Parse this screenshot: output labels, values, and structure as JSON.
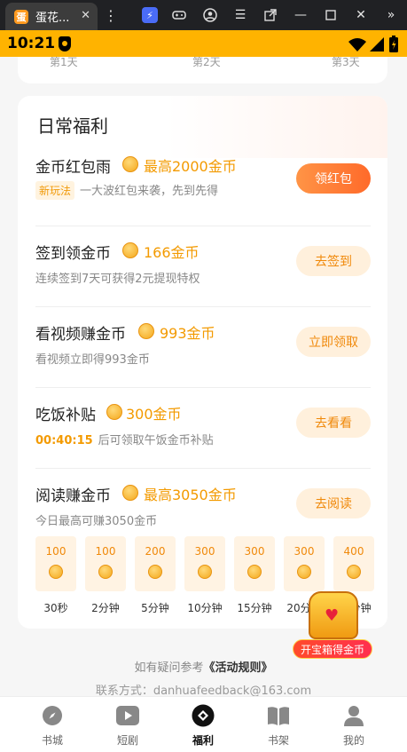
{
  "browser": {
    "tab_title": "蛋花...",
    "tab_close": "✕"
  },
  "status": {
    "time": "10:21"
  },
  "check_days": [
    "第1天",
    "第2天",
    "第3天"
  ],
  "section": {
    "title": "日常福利"
  },
  "tasks": [
    {
      "name": "金币红包雨",
      "reward": "最高2000金币",
      "badge": "新玩法",
      "desc": "一大波红包来袭，先到先得",
      "button": "领红包"
    },
    {
      "name": "签到领金币",
      "reward": "166金币",
      "desc": "连续签到7天可获得2元提现特权",
      "button": "去签到"
    },
    {
      "name": "看视频赚金币",
      "reward": "993金币",
      "desc": "看视频立即得993金币",
      "button": "立即领取"
    },
    {
      "name": "吃饭补贴",
      "reward": "300金币",
      "timer": "00:40:15",
      "desc": "后可领取午饭金币补贴",
      "button": "去看看"
    },
    {
      "name": "阅读赚金币",
      "reward": "最高3050金币",
      "desc": "今日最高可赚3050金币",
      "button": "去阅读"
    }
  ],
  "reading_tiles": [
    {
      "amount": "100",
      "label": "30秒"
    },
    {
      "amount": "100",
      "label": "2分钟"
    },
    {
      "amount": "200",
      "label": "5分钟"
    },
    {
      "amount": "300",
      "label": "10分钟"
    },
    {
      "amount": "300",
      "label": "15分钟"
    },
    {
      "amount": "300",
      "label": "20分钟"
    },
    {
      "amount": "400",
      "label": "30分钟"
    }
  ],
  "chest": {
    "label": "开宝箱得金币"
  },
  "footer": {
    "rules_prefix": "如有疑问参考",
    "rules_link": "《活动规则》",
    "contact": "联系方式：danhuafeedback@163.com"
  },
  "nav": [
    {
      "label": "书城",
      "icon": "compass-icon"
    },
    {
      "label": "短剧",
      "icon": "play-icon"
    },
    {
      "label": "福利",
      "icon": "gift-icon"
    },
    {
      "label": "书架",
      "icon": "book-icon"
    },
    {
      "label": "我的",
      "icon": "user-icon"
    }
  ],
  "colors": {
    "status_bar": "#ffb300",
    "accent": "#f39a00",
    "primary_button": "#ff6a2a"
  }
}
